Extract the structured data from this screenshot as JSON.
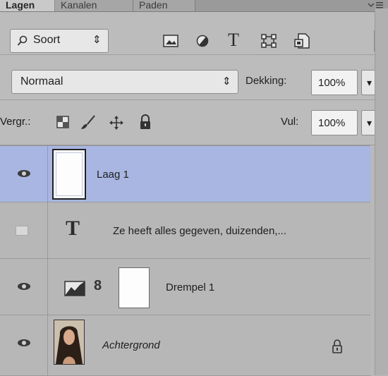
{
  "tabs": [
    {
      "label": "Lagen",
      "active": true
    },
    {
      "label": "Kanalen",
      "active": false
    },
    {
      "label": "Paden",
      "active": false
    }
  ],
  "panel_menu_icon": "panel-menu-icon",
  "filter": {
    "search_icon": "search-icon",
    "label": "Soort",
    "stepper_symbol": "⇕",
    "icons": [
      "image-filter-icon",
      "adjustment-filter-icon",
      "type-filter-icon",
      "shape-filter-icon",
      "smart-object-filter-icon"
    ]
  },
  "blend": {
    "mode": "Normaal",
    "mode_stepper": "⇕",
    "opacity_label": "Dekking:",
    "opacity_value": "100%",
    "dropdown_symbol": "▾"
  },
  "lock": {
    "label": "Vergr.:",
    "icons": [
      "lock-transparency-icon",
      "lock-image-pixels-icon",
      "lock-position-icon",
      "lock-all-icon"
    ],
    "fill_label": "Vul:",
    "fill_value": "100%",
    "dropdown_symbol": "▾"
  },
  "layers": [
    {
      "name": "Laag 1",
      "visible": true,
      "selected": true,
      "type": "pixel"
    },
    {
      "name": "Ze heeft alles gegeven, duizenden,...",
      "visible": false,
      "selected": false,
      "type": "text",
      "type_glyph": "T"
    },
    {
      "name": "Drempel 1",
      "visible": true,
      "selected": false,
      "type": "adjustment",
      "link_glyph": "8"
    },
    {
      "name": "Achtergrond",
      "visible": true,
      "selected": false,
      "type": "background",
      "locked": true
    }
  ],
  "colors": {
    "selected_row": "#a9b6e2",
    "panel_bg": "#b9b9b9"
  }
}
